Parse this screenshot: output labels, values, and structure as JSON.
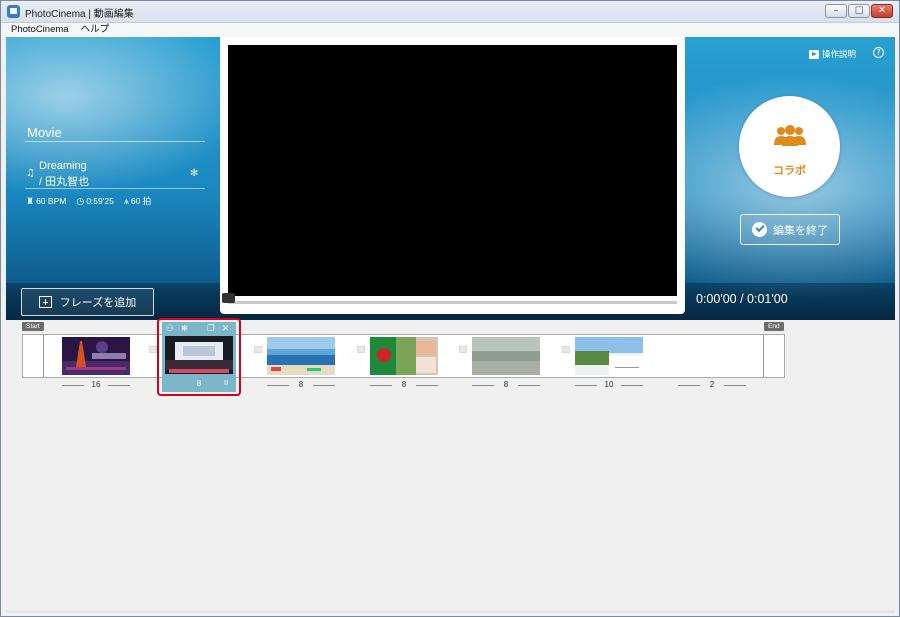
{
  "window": {
    "title": "PhotoCinema | 動画編集",
    "buttons": [
      "minimize",
      "maximize",
      "close"
    ]
  },
  "menu": {
    "items": [
      "PhotoCinema",
      "ヘルプ"
    ]
  },
  "left_panel": {
    "section_title": "Movie",
    "song_title": "Dreaming",
    "song_artist": "/ 田丸智也",
    "bpm": "60 BPM",
    "duration": "0:59'25",
    "beats": "60 拍",
    "add_phrase_label": "フレーズを追加"
  },
  "right_panel": {
    "help_label": "操作説明",
    "help_icon": "?",
    "collab_label": "コラボ",
    "finish_label": "編集を終了",
    "timecode": "0:00'00 / 0:01'00"
  },
  "timeline": {
    "start_tag": "Start",
    "end_tag": "End",
    "clips": [
      {
        "count": "16",
        "thumb": "night-city",
        "selected": false
      },
      {
        "count": "8",
        "thumb": "stage",
        "selected": true
      },
      {
        "count": "8",
        "thumb": "beach",
        "selected": false
      },
      {
        "count": "8",
        "thumb": "flower",
        "selected": false
      },
      {
        "count": "8",
        "thumb": "mist",
        "selected": false
      },
      {
        "count": "10",
        "thumb": "resort",
        "selected": false
      },
      {
        "count": "2",
        "thumb": "empty",
        "selected": false
      }
    ],
    "selected_toolbar_icons": [
      "collab-icon",
      "gear-icon",
      "copy-icon",
      "close-icon"
    ],
    "selected_pause": "II"
  },
  "colors": {
    "hero_top": "#2aa0d2",
    "hero_bottom": "#0b3e60",
    "accent_orange": "#e08a1a",
    "selected_border": "#d4001f",
    "selected_fill": "#7cb7c9"
  }
}
